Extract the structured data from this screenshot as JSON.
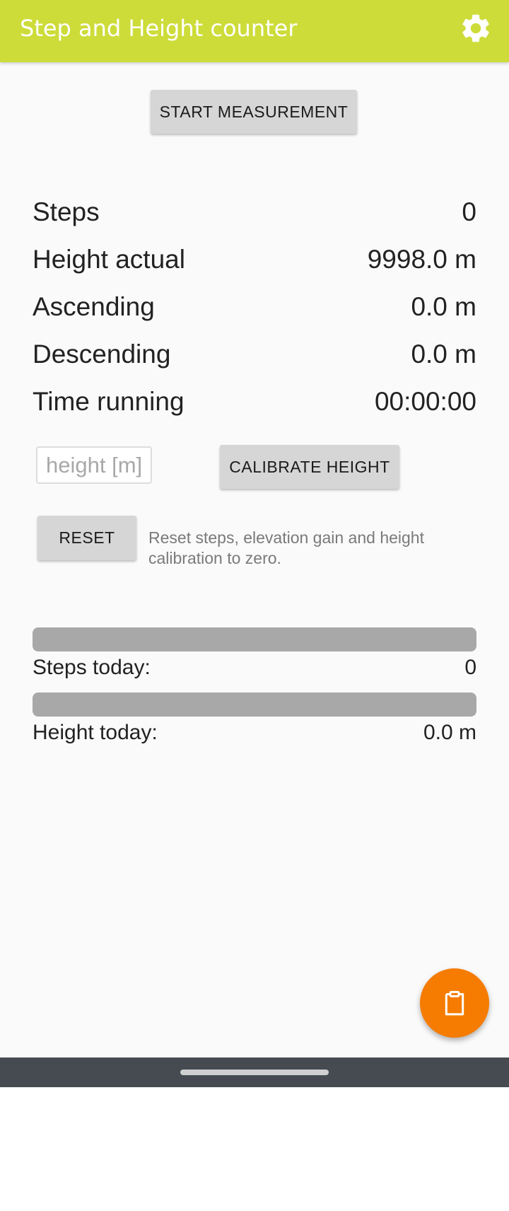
{
  "app": {
    "title": "Step and Height counter",
    "accent_color": "#cddc39",
    "fab_color": "#f57c00"
  },
  "toolbar": {
    "settings_icon": "gear-icon"
  },
  "actions": {
    "start_label": "START MEASUREMENT",
    "calibrate_label": "CALIBRATE HEIGHT",
    "reset_label": "RESET",
    "reset_description": "Reset steps, elevation gain and height calibration to zero."
  },
  "stats": [
    {
      "label": "Steps",
      "value": "0"
    },
    {
      "label": "Height actual",
      "value": "9998.0 m"
    },
    {
      "label": "Ascending",
      "value": "0.0 m"
    },
    {
      "label": "Descending",
      "value": "0.0 m"
    },
    {
      "label": "Time running",
      "value": "00:00:00"
    }
  ],
  "height_input": {
    "placeholder": "height [m]",
    "value": ""
  },
  "today": {
    "steps": {
      "label": "Steps today:",
      "value": "0",
      "progress_fraction": 0
    },
    "height": {
      "label": "Height today:",
      "value": "0.0 m",
      "progress_fraction": 0
    }
  },
  "fab": {
    "icon": "clipboard-icon"
  }
}
